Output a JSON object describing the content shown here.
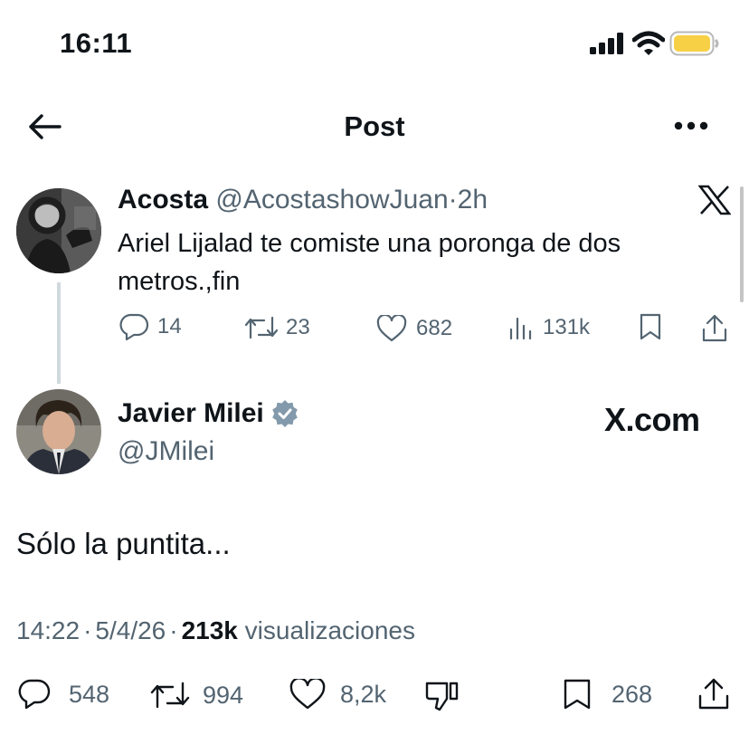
{
  "status_bar": {
    "time": "16:11"
  },
  "header": {
    "title": "Post"
  },
  "quoted_tweet": {
    "author_name": "Acosta",
    "handle": "@AcostashowJuan",
    "separator": "·",
    "time": "2h",
    "text_line1": "Ariel Lijalad te comiste una poronga de dos",
    "text_line2": "metros.,fin",
    "replies": "14",
    "retweets": "23",
    "likes": "682",
    "views": "131k",
    "icons": [
      "reply-icon",
      "retweet-icon",
      "like-icon",
      "views-icon",
      "bookmark-icon",
      "share-icon",
      "x-logo-icon"
    ]
  },
  "main_tweet": {
    "author_name": "Javier Milei",
    "handle": "@JMilei",
    "verified": true,
    "watermark": "X.com",
    "text": "Sólo la puntita...",
    "time": "14:22",
    "date": "5/4/26",
    "dot": "·",
    "views_count": "213k",
    "views_label": "visualizaciones",
    "replies": "548",
    "retweets": "994",
    "likes": "8,2k",
    "bookmarks": "268"
  },
  "colors": {
    "text": "#0f1419",
    "secondary": "#536471",
    "verified": "#829aab",
    "battery": "#f7d046"
  }
}
